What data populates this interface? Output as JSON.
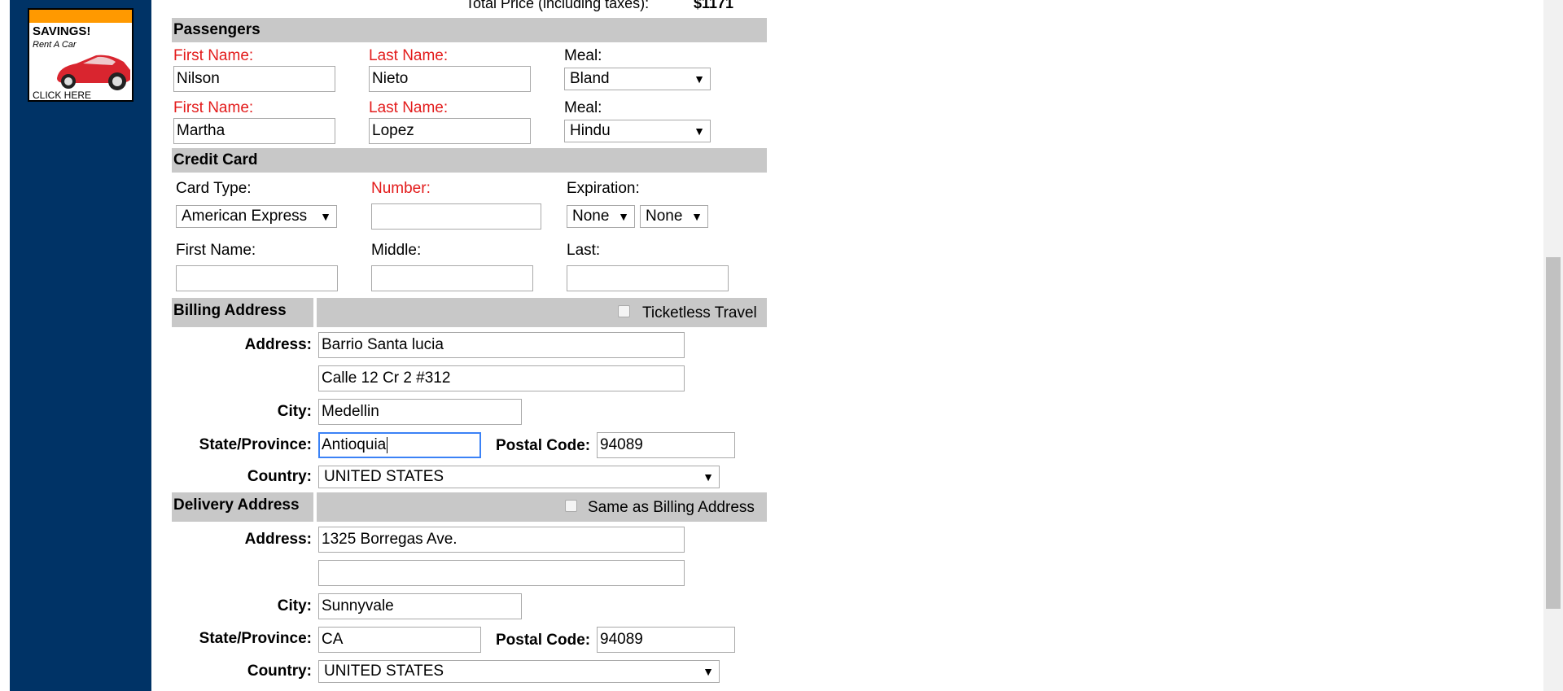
{
  "ad": {
    "headline": "SAVINGS!",
    "subline": "Rent A Car",
    "cta": "CLICK HERE",
    "colors": {
      "top_bar": "#ff9900",
      "car": "#d9252f"
    }
  },
  "summary": {
    "total_label": "Total Price (including taxes):",
    "total_value": "$1171"
  },
  "passengers": {
    "title": "Passengers",
    "rows": [
      {
        "first_label": "First Name:",
        "first_value": "Nilson",
        "last_label": "Last Name:",
        "last_value": "Nieto",
        "meal_label": "Meal:",
        "meal_value": "Bland"
      },
      {
        "first_label": "First Name:",
        "first_value": "Martha",
        "last_label": "Last Name:",
        "last_value": "Lopez",
        "meal_label": "Meal:",
        "meal_value": "Hindu"
      }
    ]
  },
  "credit_card": {
    "title": "Credit Card",
    "card_type_label": "Card Type:",
    "card_type_value": "American Express",
    "number_label": "Number:",
    "number_value": "",
    "expiration_label": "Expiration:",
    "exp_month_value": "None",
    "exp_year_value": "None",
    "first_label": "First Name:",
    "first_value": "",
    "middle_label": "Middle:",
    "middle_value": "",
    "last_label": "Last:",
    "last_value": ""
  },
  "billing": {
    "title": "Billing Address",
    "checkbox_label": "Ticketless Travel",
    "checkbox_checked": false,
    "address_label": "Address:",
    "address1": "Barrio Santa lucia",
    "address2": "Calle 12 Cr 2 #312",
    "city_label": "City:",
    "city": "Medellin",
    "state_label": "State/Province:",
    "state": "Antioquia",
    "postal_label": "Postal Code:",
    "postal": "94089",
    "country_label": "Country:",
    "country": "UNITED STATES"
  },
  "delivery": {
    "title": "Delivery Address",
    "checkbox_label": "Same as Billing Address",
    "checkbox_checked": false,
    "address_label": "Address:",
    "address1": "1325 Borregas Ave.",
    "address2": "",
    "city_label": "City:",
    "city": "Sunnyvale",
    "state_label": "State/Province:",
    "state": "CA",
    "postal_label": "Postal Code:",
    "postal": "94089",
    "country_label": "Country:",
    "country": "UNITED STATES"
  },
  "theme": {
    "sidebar": "#003366",
    "section_header": "#c8c8c8",
    "required_label": "#e31b1b",
    "focus_border": "#3b82f6"
  }
}
